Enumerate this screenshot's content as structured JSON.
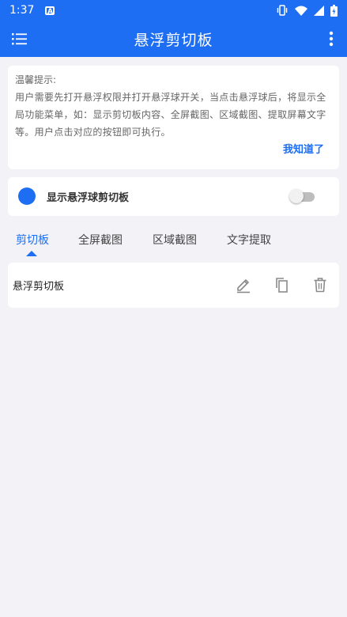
{
  "status_bar": {
    "time": "1:37",
    "notification_icon": "a-square-icon",
    "right_icons": [
      "vibrate-icon",
      "wifi-icon",
      "signal-icon",
      "battery-icon"
    ]
  },
  "app_bar": {
    "title": "悬浮剪切板",
    "left_icon": "list-menu-icon",
    "right_icon": "more-vert-icon",
    "background_color": "#1e6ef3"
  },
  "tip": {
    "heading": "温馨提示:",
    "body": "用户需要先打开悬浮权限并打开悬浮球开关，当点击悬浮球后，将显示全局功能菜单，如：显示剪切板内容、全屏截图、区域截图、提取屏幕文字等。用户点击对应的按钮即可执行。",
    "ack_label": "我知道了"
  },
  "toggle_row": {
    "label": "显示悬浮球剪切板",
    "enabled": false
  },
  "tabs": [
    {
      "label": "剪切板",
      "active": true
    },
    {
      "label": "全屏截图",
      "active": false
    },
    {
      "label": "区域截图",
      "active": false
    },
    {
      "label": "文字提取",
      "active": false
    }
  ],
  "clip_items": [
    {
      "text": "悬浮剪切板",
      "actions": [
        "edit-icon",
        "copy-icon",
        "delete-icon"
      ]
    }
  ],
  "colors": {
    "accent": "#1e6ef3",
    "background": "#f2f2f7",
    "card": "#ffffff"
  }
}
